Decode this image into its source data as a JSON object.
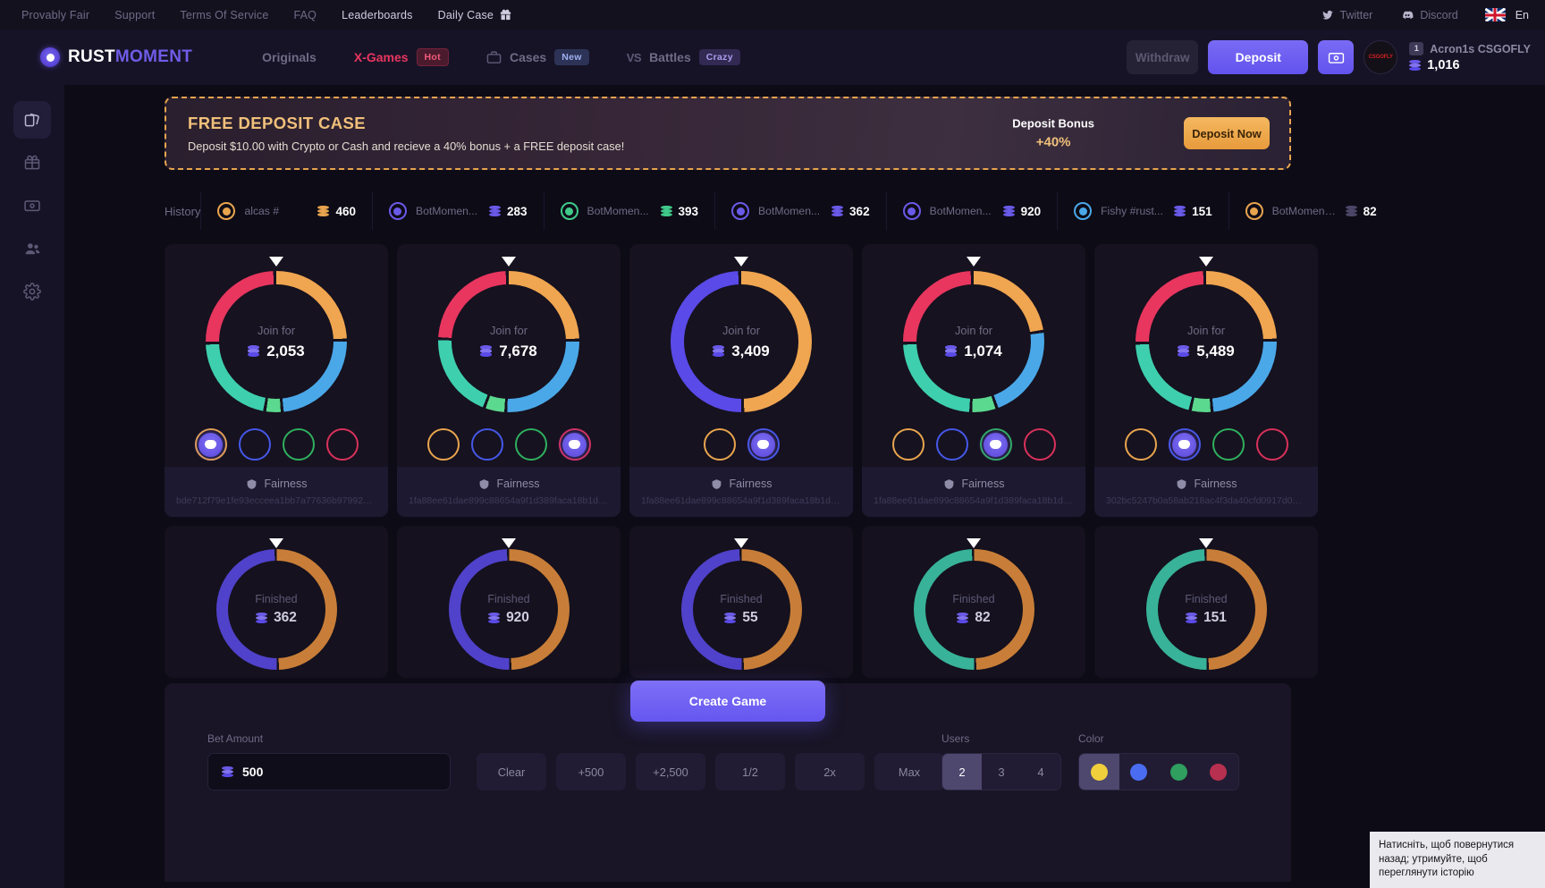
{
  "topbar": {
    "links": [
      {
        "label": "Provably Fair",
        "bright": false
      },
      {
        "label": "Support",
        "bright": false
      },
      {
        "label": "Terms Of Service",
        "bright": false
      },
      {
        "label": "FAQ",
        "bright": false
      },
      {
        "label": "Leaderboards",
        "bright": true
      },
      {
        "label": "Daily Case",
        "bright": true
      }
    ],
    "gift_icon": "gift-icon",
    "twitter": "Twitter",
    "discord": "Discord",
    "language": "En"
  },
  "nav": {
    "logo_first": "RUST",
    "logo_second": "MOMENT",
    "items": [
      {
        "label": "Originals",
        "badge": "",
        "badge_type": "",
        "pink": false,
        "icon": ""
      },
      {
        "label": "X-Games",
        "badge": "Hot",
        "badge_type": "hot",
        "pink": true,
        "icon": ""
      },
      {
        "label": "Cases",
        "badge": "New",
        "badge_type": "new",
        "pink": false,
        "icon": "case-icon"
      },
      {
        "label": "Battles",
        "badge": "Crazy",
        "badge_type": "crazy",
        "pink": false,
        "icon": "vs-icon"
      }
    ],
    "withdraw_label": "Withdraw",
    "deposit_label": "Deposit",
    "wallet_icon": "wallet-icon",
    "avatar_text": "CSGOFLY",
    "user_level": "1",
    "user_name": "Acron1s CSGOFLY",
    "user_balance": "1,016"
  },
  "sidebar": {
    "items": [
      {
        "name": "sidebar-item-games",
        "icon": "cards-icon",
        "active": true
      },
      {
        "name": "sidebar-item-cases",
        "icon": "gift-box-icon",
        "active": false
      },
      {
        "name": "sidebar-item-wallet",
        "icon": "wallet-icon",
        "active": false
      },
      {
        "name": "sidebar-item-affiliates",
        "icon": "users-icon",
        "active": false
      },
      {
        "name": "sidebar-item-settings",
        "icon": "gear-icon",
        "active": false
      }
    ]
  },
  "banner": {
    "title": "FREE DEPOSIT CASE",
    "subtitle": "Deposit $10.00 with Crypto or Cash and recieve a 40% bonus + a FREE deposit case!",
    "bonus_label": "Deposit Bonus",
    "bonus_value": "+40%",
    "cta_label": "Deposit Now",
    "accent": "#e8a44e"
  },
  "history": {
    "label": "History",
    "items": [
      {
        "name": "alcas #",
        "amount": "460",
        "ring": "#e8a44e",
        "coin": "#e8a44e",
        "avatar": "#e8a44e"
      },
      {
        "name": "BotMomen...",
        "amount": "283",
        "ring": "#6a5ae8",
        "coin": "#6a5ae8",
        "avatar": "#6a5ae8"
      },
      {
        "name": "BotMomen...",
        "amount": "393",
        "ring": "#3fc98a",
        "coin": "#3fc98a",
        "avatar": "#3fc98a"
      },
      {
        "name": "BotMomen...",
        "amount": "362",
        "ring": "#6a5ae8",
        "coin": "#6a5ae8",
        "avatar": "#6a5ae8"
      },
      {
        "name": "BotMomen...",
        "amount": "920",
        "ring": "#6a5ae8",
        "coin": "#6a5ae8",
        "avatar": "#6a5ae8"
      },
      {
        "name": "Fishy #rust...",
        "amount": "151",
        "ring": "#4aa8e8",
        "coin": "#6a5ae8",
        "avatar": "#4aa8e8"
      },
      {
        "name": "BotMoment...",
        "amount": "82",
        "ring": "#e8a44e",
        "coin": "#4c4768",
        "avatar": "#e8a44e"
      }
    ]
  },
  "games": {
    "join_label": "Join for",
    "finished_label": "Finished",
    "fairness_label": "Fairness",
    "active": [
      {
        "amount": "2,053",
        "hash": "bde712f79e1fe93ecceea1bb7a77636b97992005a...",
        "segments": [
          {
            "color": "#f0a550",
            "pct": 25
          },
          {
            "color": "#4aa8e8",
            "pct": 24
          },
          {
            "color": "#5bd98e",
            "pct": 4
          },
          {
            "color": "#3ecfae",
            "pct": 22
          },
          {
            "color": "#e8365f",
            "pct": 25
          }
        ],
        "slots": [
          {
            "ring": "#e8a44e",
            "filled": true
          },
          {
            "ring": "#4558e8",
            "filled": false
          },
          {
            "ring": "#2faf5e",
            "filled": false
          },
          {
            "ring": "#d8315b",
            "filled": false
          }
        ]
      },
      {
        "amount": "7,678",
        "hash": "1fa88ee61dae899c88654a9f1d389faca18b1db3...",
        "segments": [
          {
            "color": "#f0a550",
            "pct": 25
          },
          {
            "color": "#4aa8e8",
            "pct": 26
          },
          {
            "color": "#5bd98e",
            "pct": 5
          },
          {
            "color": "#3ecfae",
            "pct": 20
          },
          {
            "color": "#e8365f",
            "pct": 24
          }
        ],
        "slots": [
          {
            "ring": "#e8a44e",
            "filled": false
          },
          {
            "ring": "#4558e8",
            "filled": false
          },
          {
            "ring": "#2faf5e",
            "filled": false
          },
          {
            "ring": "#d8315b",
            "filled": true
          }
        ]
      },
      {
        "amount": "3,409",
        "hash": "1fa88ee61dae899c88654a9f1d389faca18b1db3...",
        "segments": [
          {
            "color": "#f0a550",
            "pct": 50
          },
          {
            "color": "#5a4ae8",
            "pct": 50
          }
        ],
        "slots": [
          {
            "ring": "#e8a44e",
            "filled": false
          },
          {
            "ring": "#4558e8",
            "filled": true
          }
        ]
      },
      {
        "amount": "1,074",
        "hash": "1fa88ee61dae899c88654a9f1d389faca18b1db3...",
        "segments": [
          {
            "color": "#f0a550",
            "pct": 23
          },
          {
            "color": "#4aa8e8",
            "pct": 22
          },
          {
            "color": "#5bd98e",
            "pct": 6
          },
          {
            "color": "#3ecfae",
            "pct": 24
          },
          {
            "color": "#e8365f",
            "pct": 25
          }
        ],
        "slots": [
          {
            "ring": "#e8a44e",
            "filled": false
          },
          {
            "ring": "#4558e8",
            "filled": false
          },
          {
            "ring": "#2faf5e",
            "filled": true
          },
          {
            "ring": "#d8315b",
            "filled": false
          }
        ]
      },
      {
        "amount": "5,489",
        "hash": "302bc5247b0a58ab218ac4f3da40cfd0917d0786...",
        "segments": [
          {
            "color": "#f0a550",
            "pct": 25
          },
          {
            "color": "#4aa8e8",
            "pct": 24
          },
          {
            "color": "#5bd98e",
            "pct": 5
          },
          {
            "color": "#3ecfae",
            "pct": 21
          },
          {
            "color": "#e8365f",
            "pct": 25
          }
        ],
        "slots": [
          {
            "ring": "#e8a44e",
            "filled": false
          },
          {
            "ring": "#4558e8",
            "filled": true
          },
          {
            "ring": "#2faf5e",
            "filled": false
          },
          {
            "ring": "#d8315b",
            "filled": false
          }
        ]
      }
    ],
    "finished": [
      {
        "amount": "362",
        "left_color": "#5a4ae8",
        "right_color": "#e8913c"
      },
      {
        "amount": "920",
        "left_color": "#5a4ae8",
        "right_color": "#e8913c"
      },
      {
        "amount": "55",
        "left_color": "#5a4ae8",
        "right_color": "#e8913c"
      },
      {
        "amount": "82",
        "left_color": "#3ecfae",
        "right_color": "#e8913c"
      },
      {
        "amount": "151",
        "left_color": "#3ecfae",
        "right_color": "#e8913c"
      }
    ]
  },
  "create_game": {
    "label": "Create Game"
  },
  "controls": {
    "bet_label": "Bet Amount",
    "bet_value": "500",
    "quick": [
      "Clear",
      "+500",
      "+2,500",
      "1/2",
      "2x",
      "Max"
    ],
    "users_label": "Users",
    "users_options": [
      "2",
      "3",
      "4"
    ],
    "users_selected": "2",
    "color_label": "Color",
    "colors": [
      "#f0cf3c",
      "#4a6cf0",
      "#2f9e5e",
      "#b8304f"
    ],
    "color_selected_index": 0
  },
  "tooltip": {
    "text": "Натисніть, щоб повернутися назад; утримуйте, щоб переглянути історію"
  }
}
